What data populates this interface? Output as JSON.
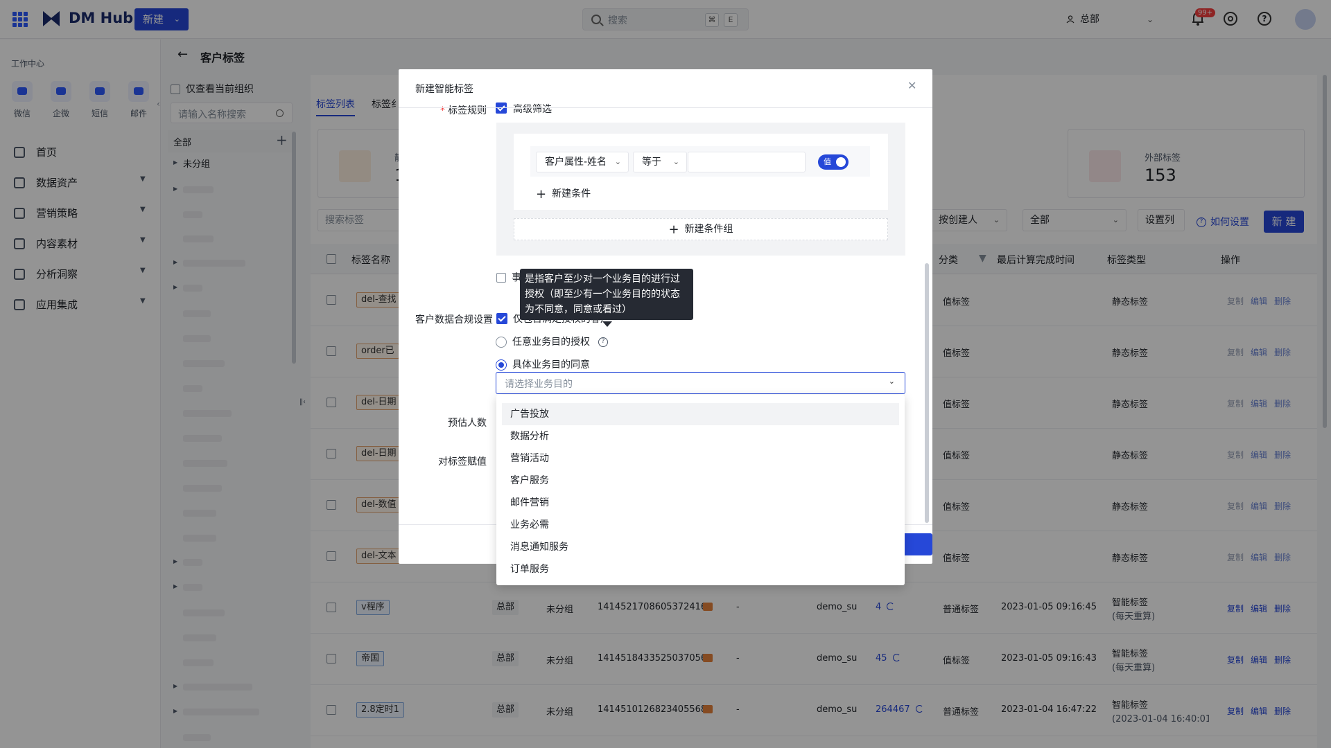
{
  "topbar": {
    "logo": "DM Hub",
    "new_label": "新建",
    "search_placeholder": "搜索",
    "kbd1": "⌘",
    "kbd2": "E",
    "org": "总部",
    "notif_badge": "99+"
  },
  "leftnav": {
    "workcenter": "工作中心",
    "quick": [
      "微信",
      "企微",
      "短信",
      "邮件"
    ],
    "items": [
      "首页",
      "数据资产",
      "营销策略",
      "内容素材",
      "分析洞察",
      "应用集成"
    ]
  },
  "page": {
    "title": "客户标签"
  },
  "tree": {
    "org_only": "仅查看当前组织",
    "search_placeholder": "请输入名称搜索",
    "all": "全部",
    "ungrouped": "未分组"
  },
  "main": {
    "tabs": [
      "标签列表",
      "标签纟"
    ],
    "stat_left_label": "静",
    "stat_left_value": "1",
    "stat_right_label": "外部标签",
    "stat_right_value": "153",
    "search_placeholder": "搜索标签",
    "filter_creator": "按创建人",
    "filter_all": "全部",
    "set_columns": "设置列",
    "how_to": "如何设置",
    "new_label": "新 建",
    "headers": {
      "name": "标签名称",
      "category": "分类",
      "last_calc": "最后计算完成时间",
      "type": "标签类型",
      "ops": "操作"
    },
    "rows": [
      {
        "name": "del-查找",
        "category": "值标签",
        "type": "静态标签"
      },
      {
        "name": "order已",
        "category": "值标签",
        "type": "静态标签"
      },
      {
        "name": "del-日期",
        "category": "值标签",
        "type": "静态标签"
      },
      {
        "name": "del-日期",
        "category": "值标签",
        "type": "静态标签"
      },
      {
        "name": "del-数值",
        "category": "值标签",
        "type": "静态标签"
      },
      {
        "name": "del-文本",
        "category": "值标签",
        "type": "静态标签"
      },
      {
        "name": "v程序",
        "org": "总部",
        "group": "未分组",
        "id": "1414521708605372416",
        "desc": "-",
        "creator": "demo_su",
        "count": "4",
        "category": "普通标签",
        "last_calc": "2023-01-05 09:16:45",
        "type": "智能标签",
        "type_sub": "(每天重算)"
      },
      {
        "name": "帝国",
        "org": "总部",
        "group": "未分组",
        "id": "1414518433525037056",
        "desc": "-",
        "creator": "demo_su",
        "count": "45",
        "category": "值标签",
        "last_calc": "2023-01-05 09:16:43",
        "type": "智能标签",
        "type_sub": "(每天重算)"
      },
      {
        "name": "2.8定时1",
        "org": "总部",
        "group": "未分组",
        "id": "1414510126823405568",
        "desc": "-",
        "creator": "demo_su",
        "count": "264467",
        "category": "普通标签",
        "last_calc": "2023-01-04 16:47:22",
        "type": "智能标签",
        "type_sub": "(2023-01-04 16:40:01重"
      }
    ],
    "op_copy": "复制",
    "op_edit": "编辑",
    "op_delete": "删除"
  },
  "modal": {
    "title": "新建智能标签",
    "rule_label": "标签规则",
    "rule_check_text": "高级筛选",
    "cond_attr": "客户属性-姓名",
    "cond_op": "等于",
    "cond_toggle": "值",
    "add_condition": "新建条件",
    "add_group": "新建条件组",
    "event_text": "事件筛选",
    "compliance_label": "客户数据合规设置",
    "compliance_check_text": "仅包含满足授权的客户",
    "radio_any": "任意业务目的授权",
    "radio_specific": "具体业务目的同意",
    "purpose_placeholder": "请选择业务目的",
    "estimate_label": "预估人数",
    "assign_label": "对标签赋值"
  },
  "tooltip": {
    "text": "是指客户至少对一个业务目的进行过授权（即至少有一个业务目的的状态为不同意，同意或看过）"
  },
  "dropdown": {
    "options": [
      "广告投放",
      "数据分析",
      "营销活动",
      "客户服务",
      "邮件营销",
      "业务必需",
      "消息通知服务",
      "订单服务"
    ]
  }
}
